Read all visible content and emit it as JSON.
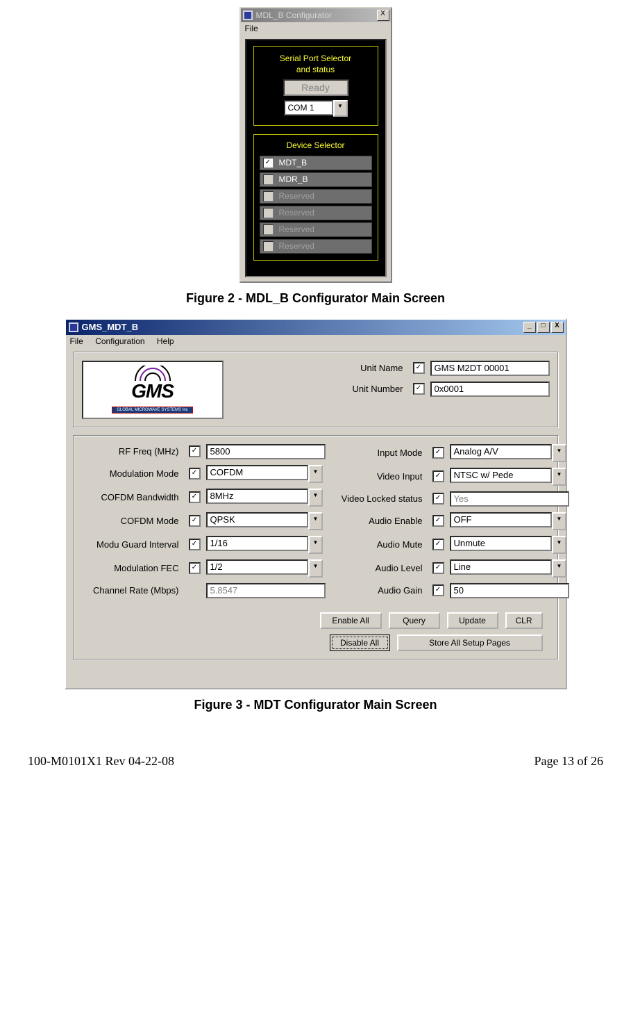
{
  "win1": {
    "title": "MDL_B Configurator",
    "menu": {
      "file": "File"
    },
    "serial_group_label_line1": "Serial Port Selector",
    "serial_group_label_line2": "and status",
    "status": "Ready",
    "com_value": "COM 1",
    "device_group_label": "Device Selector",
    "devices": [
      {
        "label": "MDT_B",
        "checked": true,
        "enabled": true
      },
      {
        "label": "MDR_B",
        "checked": false,
        "enabled": true
      },
      {
        "label": "Reserved",
        "checked": false,
        "enabled": false
      },
      {
        "label": "Reserved",
        "checked": false,
        "enabled": false
      },
      {
        "label": "Reserved",
        "checked": false,
        "enabled": false
      },
      {
        "label": "Reserved",
        "checked": false,
        "enabled": false
      }
    ]
  },
  "caption1": "Figure 2 - MDL_B Configurator Main Screen",
  "win2": {
    "title": "GMS_MDT_B",
    "menu": {
      "file": "File",
      "configuration": "Configuration",
      "help": "Help"
    },
    "logo_text": "GMS",
    "logo_sub": "GLOBAL MICROWAVE SYSTEMS Inc",
    "unit_name_label": "Unit Name",
    "unit_name_value": "GMS M2DT 00001",
    "unit_number_label": "Unit Number",
    "unit_number_value": "0x0001",
    "left_fields": [
      {
        "label": "RF Freq (MHz)",
        "value": "5800",
        "type": "text"
      },
      {
        "label": "Modulation Mode",
        "value": "COFDM",
        "type": "drop"
      },
      {
        "label": "COFDM Bandwidth",
        "value": "8MHz",
        "type": "drop"
      },
      {
        "label": "COFDM Mode",
        "value": "QPSK",
        "type": "drop"
      },
      {
        "label": "Modu Guard Interval",
        "value": "1/16",
        "type": "drop"
      },
      {
        "label": "Modulation FEC",
        "value": "1/2",
        "type": "drop"
      },
      {
        "label": "Channel Rate (Mbps)",
        "value": "5.8547",
        "type": "readonly"
      }
    ],
    "right_fields": [
      {
        "label": "Input Mode",
        "value": "Analog A/V",
        "type": "drop"
      },
      {
        "label": "Video Input",
        "value": "NTSC w/ Pede",
        "type": "drop"
      },
      {
        "label": "Video Locked status",
        "value": "Yes",
        "type": "readonly"
      },
      {
        "label": "Audio Enable",
        "value": "OFF",
        "type": "drop"
      },
      {
        "label": "Audio Mute",
        "value": "Unmute",
        "type": "drop"
      },
      {
        "label": "Audio Level",
        "value": "Line",
        "type": "drop"
      },
      {
        "label": "Audio Gain",
        "value": "50",
        "type": "text"
      }
    ],
    "buttons": {
      "enable_all": "Enable All",
      "query": "Query",
      "update": "Update",
      "clr": "CLR",
      "disable_all": "Disable All",
      "store_all": "Store All Setup Pages"
    }
  },
  "caption2": "Figure 3 - MDT Configurator Main Screen",
  "footer_left": "100-M0101X1 Rev 04-22-08",
  "footer_right": "Page 13 of 26"
}
